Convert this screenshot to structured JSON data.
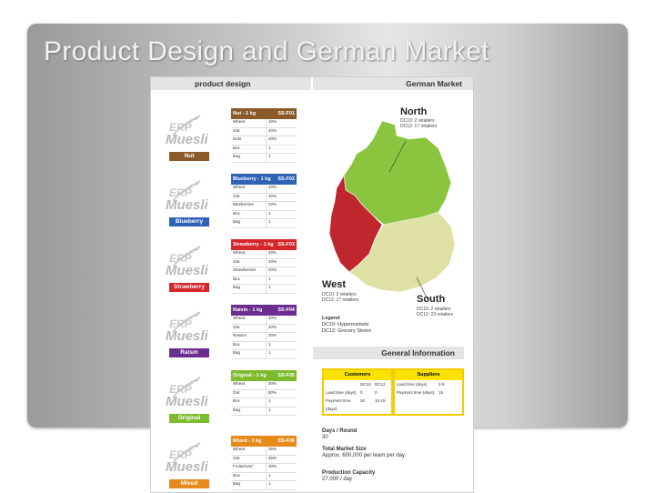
{
  "slide": {
    "title": "Product Design and German Market"
  },
  "left_header": "product design",
  "right_header": "German Market",
  "products": [
    {
      "variant": "Nut",
      "header": "Nut - 1 kg",
      "code": "SS-F01",
      "color": "#8a5a2b",
      "rows": [
        [
          "Wheat",
          "40%"
        ],
        [
          "Oat",
          "40%"
        ],
        [
          "Nuts",
          "20%"
        ],
        [
          "Box",
          "1"
        ],
        [
          "Bag",
          "1"
        ]
      ]
    },
    {
      "variant": "Blueberry",
      "header": "Blueberry - 1 kg",
      "code": "SS-F02",
      "color": "#2d62b4",
      "rows": [
        [
          "Wheat",
          "40%"
        ],
        [
          "Oat",
          "40%"
        ],
        [
          "Blueberries",
          "20%"
        ],
        [
          "Box",
          "1"
        ],
        [
          "Bag",
          "1"
        ]
      ]
    },
    {
      "variant": "Strawberry",
      "header": "Strawberry - 1 kg",
      "code": "SS-F03",
      "color": "#d5262b",
      "rows": [
        [
          "Wheat",
          "40%"
        ],
        [
          "Oat",
          "40%"
        ],
        [
          "Strawberries",
          "20%"
        ],
        [
          "Box",
          "1"
        ],
        [
          "Bag",
          "1"
        ]
      ]
    },
    {
      "variant": "Raisin",
      "header": "Raisin - 1 kg",
      "code": "SS-F04",
      "color": "#6b2d8f",
      "rows": [
        [
          "Wheat",
          "40%"
        ],
        [
          "Oat",
          "40%"
        ],
        [
          "Raisins",
          "20%"
        ],
        [
          "Box",
          "1"
        ],
        [
          "Bag",
          "1"
        ]
      ]
    },
    {
      "variant": "Original",
      "header": "Original - 1 kg",
      "code": "SS-F05",
      "color": "#7dbb2d",
      "rows": [
        [
          "Wheat",
          "50%"
        ],
        [
          "Oat",
          "50%"
        ],
        [
          "Box",
          "1"
        ],
        [
          "Bag",
          "1"
        ]
      ]
    },
    {
      "variant": "Mixed",
      "header": "Mixed - 1 kg",
      "code": "SS-F06",
      "color": "#e78a1c",
      "rows": [
        [
          "Wheat",
          "35%"
        ],
        [
          "Oat",
          "35%"
        ],
        [
          "Fruits/nuts*",
          "30%"
        ],
        [
          "Box",
          "1"
        ],
        [
          "Bag",
          "1"
        ]
      ]
    }
  ],
  "regions": {
    "north": {
      "title": "North",
      "line1": "DC10: 2 retailers",
      "line2": "DC12: 17 retailers"
    },
    "west": {
      "title": "West",
      "line1": "DC10: 2 retailers",
      "line2": "DC12: 17 retailers"
    },
    "south": {
      "title": "South",
      "line1": "DC10: 2 retailers",
      "line2": "DC12: 23 retailers"
    }
  },
  "legend": {
    "title": "Legend",
    "line1": "DC10: Hypermarkets",
    "line2": "DC12: Grocery Stores"
  },
  "general_info": {
    "header": "General Information",
    "customers": {
      "title": "Customers",
      "cols": [
        "DC10",
        "DC12"
      ],
      "rows": [
        [
          "Lead time (days)",
          "0",
          "0"
        ],
        [
          "Payment time (days)",
          "30",
          "10-15"
        ]
      ]
    },
    "suppliers": {
      "title": "Suppliers",
      "rows": [
        [
          "Lead time (days)",
          "2-5"
        ],
        [
          "Payment time (days)",
          "15"
        ]
      ]
    },
    "days_round_label": "Days / Round",
    "days_round_value": "30",
    "market_size_label": "Total Market Size",
    "market_size_value": "Approx. 600,000 per team per day",
    "capacity_label": "Production Capacity",
    "capacity_value": "27,000 / day"
  },
  "colors": {
    "north": "#8bc53f",
    "west": "#c0262d",
    "south": "#dfe0a4",
    "accent": "#f9e200"
  }
}
